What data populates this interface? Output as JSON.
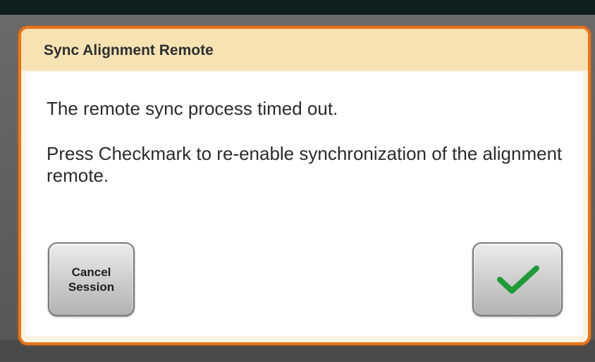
{
  "dialog": {
    "title": "Sync Alignment Remote",
    "message_1": "The remote sync process timed out.",
    "message_2": "Press Checkmark to re-enable synchronization of the alignment remote."
  },
  "buttons": {
    "cancel_label": "Cancel\nSession",
    "confirm_icon": "checkmark-icon"
  },
  "colors": {
    "dialog_border": "#e8751a",
    "header_background": "#f6e2b3",
    "checkmark": "#1f9a3a"
  }
}
